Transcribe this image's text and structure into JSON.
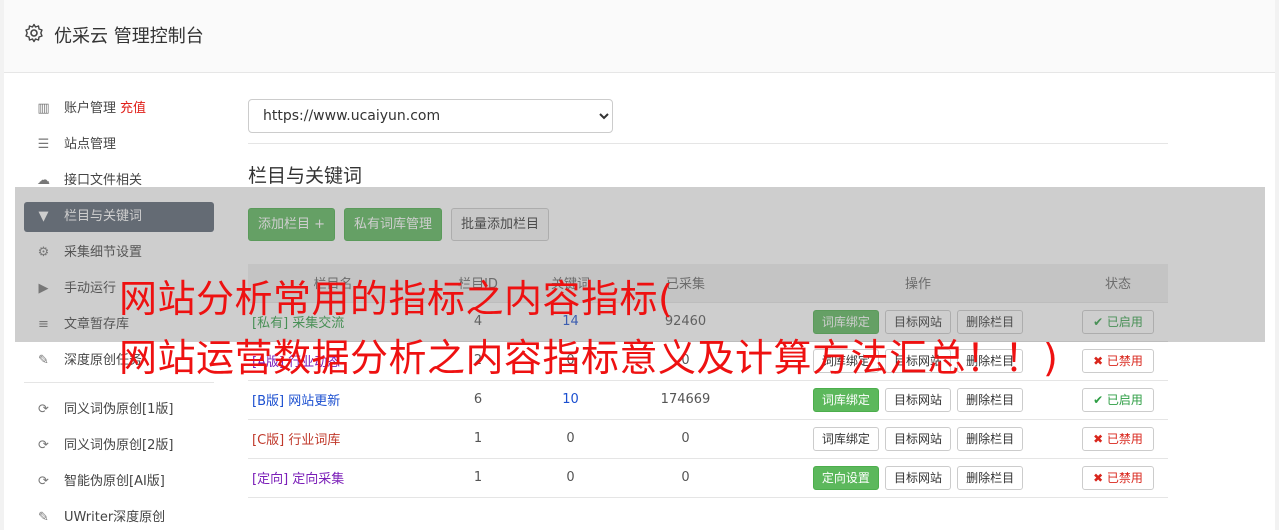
{
  "header": {
    "title": "优采云 管理控制台"
  },
  "sidebar": {
    "items": [
      {
        "label": "账户管理",
        "extra": "充值",
        "icon": "bar-chart-icon",
        "glyph": "▥"
      },
      {
        "label": "站点管理",
        "icon": "server-icon",
        "glyph": "☰"
      },
      {
        "label": "接口文件相关",
        "icon": "cloud-upload-icon",
        "glyph": "☁"
      },
      {
        "label": "栏目与关键词",
        "icon": "filter-icon",
        "glyph": "▼",
        "active": true
      },
      {
        "label": "采集细节设置",
        "icon": "cogs-icon",
        "glyph": "⚙"
      },
      {
        "label": "手动运行",
        "icon": "play-circle-icon",
        "glyph": "▶"
      },
      {
        "label": "文章暂存库",
        "icon": "database-icon",
        "glyph": "≡"
      },
      {
        "label": "深度原创任务",
        "icon": "edit-icon",
        "glyph": "✎"
      },
      {
        "label": "同义词伪原创[1版]",
        "icon": "refresh-icon",
        "glyph": "⟳"
      },
      {
        "label": "同义词伪原创[2版]",
        "icon": "refresh-icon",
        "glyph": "⟳"
      },
      {
        "label": "智能伪原创[AI版]",
        "icon": "refresh-icon",
        "glyph": "⟳"
      },
      {
        "label": "UWriter深度原创",
        "icon": "edit-icon",
        "glyph": "✎"
      }
    ]
  },
  "site_select": {
    "value": "https://www.ucaiyun.com"
  },
  "section": {
    "title": "栏目与关键词"
  },
  "toolbar": {
    "add_column": "添加栏目 +",
    "private_lib": "私有词库管理",
    "batch_add": "批量添加栏目"
  },
  "table": {
    "headers": [
      "栏目名",
      "栏目ID",
      "关键词",
      "已采集",
      "操作",
      "状态"
    ],
    "rows": [
      {
        "tag": "[私有]",
        "name": "采集交流",
        "color": "green",
        "id": "4",
        "keywords": "14",
        "collected": "92460",
        "btn1": "词库绑定",
        "btn1_green": true,
        "btn2": "目标网站",
        "btn3": "删除栏目",
        "status": "✔ 已启用",
        "enabled": true
      },
      {
        "tag": "[A版]",
        "name": "行业动态",
        "color": "purple",
        "id": "2",
        "keywords": "0",
        "collected": "0",
        "btn1": "词库绑定",
        "btn1_green": false,
        "btn2": "目标网站",
        "btn3": "删除栏目",
        "status": "✖ 已禁用",
        "enabled": false
      },
      {
        "tag": "[B版]",
        "name": "网站更新",
        "color": "blue",
        "id": "6",
        "keywords": "10",
        "collected": "174669",
        "btn1": "词库绑定",
        "btn1_green": true,
        "btn2": "目标网站",
        "btn3": "删除栏目",
        "status": "✔ 已启用",
        "enabled": true
      },
      {
        "tag": "[C版]",
        "name": "行业词库",
        "color": "red",
        "id": "1",
        "keywords": "0",
        "collected": "0",
        "btn1": "词库绑定",
        "btn1_green": false,
        "btn2": "目标网站",
        "btn3": "删除栏目",
        "status": "✖ 已禁用",
        "enabled": false
      },
      {
        "tag": "[定向]",
        "name": "定向采集",
        "color": "purple",
        "id": "1",
        "keywords": "0",
        "collected": "0",
        "btn1": "定向设置",
        "btn1_green": true,
        "btn2": "目标网站",
        "btn3": "删除栏目",
        "status": "✖ 已禁用",
        "enabled": false
      }
    ]
  },
  "overlay_text": {
    "line1": "网站分析常用的指标之内容指标(",
    "line2": "网站运营数据分析之内容指标意义及计算方法汇总！！)"
  },
  "colors": {
    "green": "#5cb85c",
    "sidebar_active": "#5a6473",
    "headline": "#ee1111"
  }
}
